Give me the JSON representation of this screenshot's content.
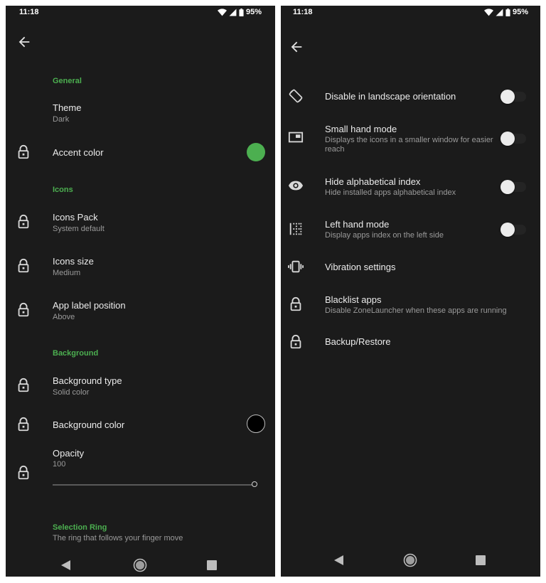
{
  "colors": {
    "accent": "#4caf50",
    "background": "#1b1b1b",
    "background_swatch": "#000000"
  },
  "status_bar": {
    "time": "11:18",
    "battery": "95%",
    "icons": [
      "wifi-icon",
      "signal-icon",
      "battery-icon"
    ]
  },
  "left_screen": {
    "back_icon": "arrow-left-icon",
    "sections": [
      {
        "category": "General",
        "items": [
          {
            "title": "Theme",
            "summary": "Dark",
            "locked": false
          },
          {
            "title": "Accent color",
            "locked": true,
            "widget": "color-swatch",
            "value": "#4caf50"
          }
        ]
      },
      {
        "category": "Icons",
        "items": [
          {
            "title": "Icons Pack",
            "summary": "System default",
            "locked": true
          },
          {
            "title": "Icons size",
            "summary": "Medium",
            "locked": true
          },
          {
            "title": "App label position",
            "summary": "Above",
            "locked": true
          }
        ]
      },
      {
        "category": "Background",
        "items": [
          {
            "title": "Background type",
            "summary": "Solid color",
            "locked": true
          },
          {
            "title": "Background color",
            "locked": true,
            "widget": "color-swatch",
            "value": "#000000"
          },
          {
            "title": "Opacity",
            "summary": "100",
            "locked": true,
            "widget": "slider",
            "slider_value_percent": 100
          }
        ]
      },
      {
        "category": "Selection Ring",
        "description": "The ring that follows your finger move"
      }
    ]
  },
  "right_screen": {
    "back_icon": "arrow-left-icon",
    "items": [
      {
        "title": "Disable in landscape orientation",
        "icon": "screen-rotation-icon",
        "toggle": false
      },
      {
        "title": "Small hand mode",
        "summary": "Displays the icons in a smaller window for easier reach",
        "icon": "picture-in-picture-icon",
        "toggle": false
      },
      {
        "title": "Hide alphabetical index",
        "summary": "Hide installed apps alphabetical index",
        "icon": "eye-icon",
        "toggle": false
      },
      {
        "title": "Left hand mode",
        "summary": "Display apps index on the left side",
        "icon": "border-left-icon",
        "toggle": false
      },
      {
        "title": "Vibration settings",
        "icon": "vibration-icon"
      },
      {
        "title": "Blacklist apps",
        "summary": "Disable ZoneLauncher when these apps are running",
        "icon": "lock-icon"
      },
      {
        "title": "Backup/Restore",
        "icon": "lock-icon"
      }
    ]
  },
  "nav_bar": {
    "buttons": [
      "back",
      "home",
      "recents"
    ]
  }
}
